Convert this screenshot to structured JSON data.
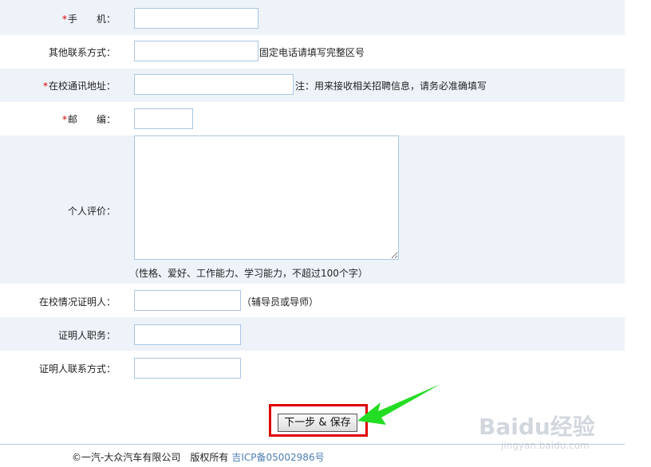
{
  "form": {
    "mobile": {
      "label": "手　　机：",
      "value": ""
    },
    "other_contact": {
      "label": "其他联系方式：",
      "value": "",
      "note": "固定电话请填写完整区号"
    },
    "address": {
      "label": "在校通讯地址：",
      "value": "",
      "note": "注：用来接收相关招聘信息，请务必准确填写"
    },
    "postcode": {
      "label": "邮　　编：",
      "value": ""
    },
    "self_eval": {
      "label": "个人评价：",
      "value": "",
      "note": "（性格、爱好、工作能力、学习能力，不超过100个字）"
    },
    "witness": {
      "label": "在校情况证明人：",
      "value": "",
      "note": "（辅导员或导师）"
    },
    "witness_title": {
      "label": "证明人职务：",
      "value": ""
    },
    "witness_contact": {
      "label": "证明人联系方式：",
      "value": ""
    },
    "required_mark": "*"
  },
  "actions": {
    "next_save_label": "下一步 & 保存"
  },
  "footer": {
    "copyright": "©一汽-大众汽车有限公司　版权所有",
    "icp": "吉ICP备05002986号"
  },
  "watermark": {
    "text": "Baidu经验",
    "sub": "jingyan.baidu.com"
  },
  "colors": {
    "row_shade": "#eef3f9",
    "input_border": "#a9c6e3",
    "highlight_box": "#e00000",
    "arrow": "#22dd22"
  }
}
